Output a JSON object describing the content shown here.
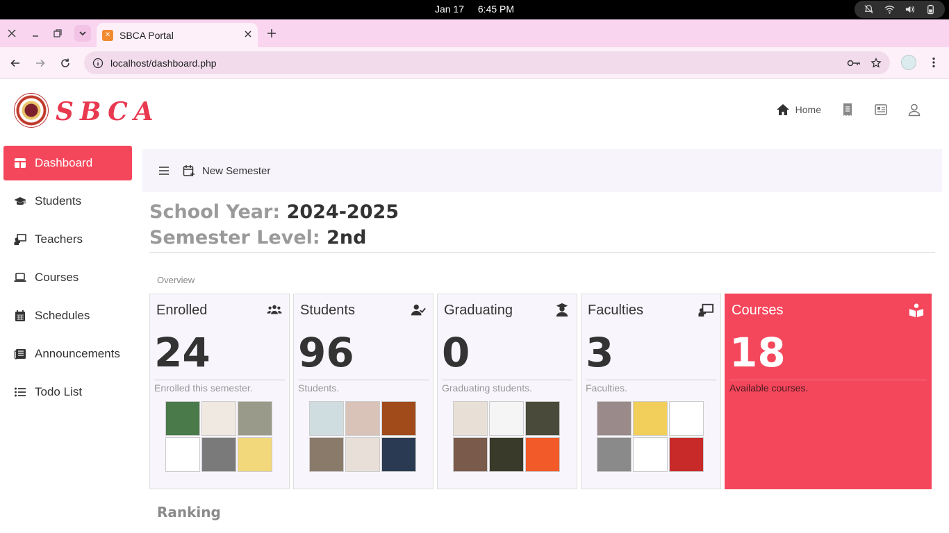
{
  "os": {
    "date": "Jan 17",
    "time": "6:45 PM"
  },
  "browser": {
    "tab_title": "SBCA Portal",
    "url": "localhost/dashboard.php"
  },
  "site": {
    "logo_text": "SBCA",
    "nav": [
      {
        "label": "Home",
        "icon": "home-icon"
      },
      {
        "label": "",
        "icon": "receipt-icon"
      },
      {
        "label": "",
        "icon": "newspaper-icon"
      },
      {
        "label": "",
        "icon": "user-icon"
      }
    ]
  },
  "sidebar": {
    "items": [
      {
        "label": "Dashboard",
        "icon": "table-icon",
        "active": true
      },
      {
        "label": "Students",
        "icon": "graduation-cap-icon"
      },
      {
        "label": "Teachers",
        "icon": "chalkboard-teacher-icon"
      },
      {
        "label": "Courses",
        "icon": "laptop-icon"
      },
      {
        "label": "Schedules",
        "icon": "calendar-icon"
      },
      {
        "label": "Announcements",
        "icon": "newspaper-icon"
      },
      {
        "label": "Todo List",
        "icon": "list-icon"
      }
    ]
  },
  "toolbar": {
    "new_semester_label": "New Semester"
  },
  "school": {
    "year_label": "School Year:",
    "year_value": "2024-2025",
    "semester_label": "Semester Level:",
    "semester_value": "2nd"
  },
  "overview_label": "Overview",
  "cards": [
    {
      "title": "Enrolled",
      "value": "24",
      "desc": "Enrolled this semester.",
      "icon": "users-icon",
      "thumbs": [
        "#4a7a4a",
        "#efe9e2",
        "#9a9a8a",
        "#ffffff",
        "#7a7a7a",
        "#f2d87a"
      ]
    },
    {
      "title": "Students",
      "value": "96",
      "desc": "Students.",
      "icon": "user-check-icon",
      "thumbs": [
        "#cfdde0",
        "#d9c2b8",
        "#a14a1a",
        "#8a7a6a",
        "#e8e0d8",
        "#2a3a52"
      ]
    },
    {
      "title": "Graduating",
      "value": "0",
      "desc": "Graduating students.",
      "icon": "user-graduate-icon",
      "thumbs": [
        "#e8e0d6",
        "#f5f5f5",
        "#4a4a3a",
        "#7a5a4a",
        "#3a3a2a",
        "#f25a2a"
      ]
    },
    {
      "title": "Faculties",
      "value": "3",
      "desc": "Faculties.",
      "icon": "chalkboard-teacher-icon",
      "thumbs": [
        "#9a8a8a",
        "#f2cf5a",
        "#ffffff",
        "#8a8a8a",
        "#ffffff",
        "#c82a2a"
      ]
    },
    {
      "title": "Courses",
      "value": "18",
      "desc": "Available courses.",
      "icon": "book-reader-icon",
      "thumbs": []
    }
  ],
  "ranking_label": "Ranking",
  "colors": {
    "accent": "#f5475c",
    "browser_chrome": "#f9d5ef"
  }
}
